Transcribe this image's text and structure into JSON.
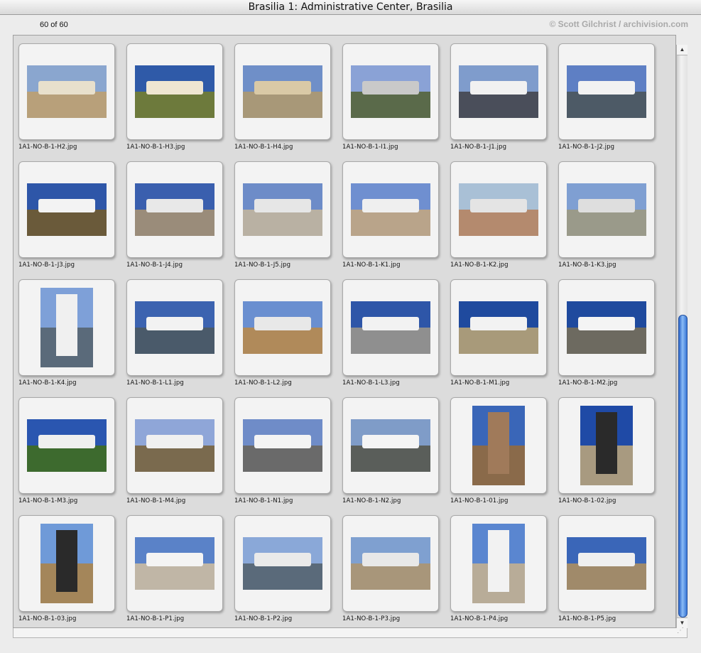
{
  "window": {
    "title": "Brasilia 1: Administrative Center, Brasilia"
  },
  "header": {
    "count": "60 of 60",
    "credit": "© Scott Gilchrist / archivision.com"
  },
  "scrollbar": {
    "up_arrow": "▲",
    "down_arrow": "▼",
    "position": 0.8
  },
  "thumbnails": [
    {
      "filename": "1A1-NO-B-1-H2.jpg",
      "orientation": "landscape",
      "sky": "#8aa6cf",
      "ground": "#b8a07a",
      "structure": "#e8e0cc"
    },
    {
      "filename": "1A1-NO-B-1-H3.jpg",
      "orientation": "landscape",
      "sky": "#2f5aa8",
      "ground": "#6d7a3c",
      "structure": "#efe6d2"
    },
    {
      "filename": "1A1-NO-B-1-H4.jpg",
      "orientation": "landscape",
      "sky": "#6f8fc8",
      "ground": "#a89878",
      "structure": "#d9c9a6"
    },
    {
      "filename": "1A1-NO-B-1-I1.jpg",
      "orientation": "landscape",
      "sky": "#8aa2d6",
      "ground": "#5a6a4a",
      "structure": "#c9c9c9"
    },
    {
      "filename": "1A1-NO-B-1-J1.jpg",
      "orientation": "landscape",
      "sky": "#7f9ccc",
      "ground": "#4a4e5a",
      "structure": "#f1f1f1"
    },
    {
      "filename": "1A1-NO-B-1-J2.jpg",
      "orientation": "landscape",
      "sky": "#5e7fc4",
      "ground": "#4d5a66",
      "structure": "#f2f2f2"
    },
    {
      "filename": "1A1-NO-B-1-J3.jpg",
      "orientation": "landscape",
      "sky": "#2e56a8",
      "ground": "#6a5a3a",
      "structure": "#f3f3f3"
    },
    {
      "filename": "1A1-NO-B-1-J4.jpg",
      "orientation": "landscape",
      "sky": "#3a5fae",
      "ground": "#9a8c7a",
      "structure": "#e8e8e8"
    },
    {
      "filename": "1A1-NO-B-1-J5.jpg",
      "orientation": "landscape",
      "sky": "#6d8cc8",
      "ground": "#b9b1a3",
      "structure": "#e6e6e6"
    },
    {
      "filename": "1A1-NO-B-1-K1.jpg",
      "orientation": "landscape",
      "sky": "#6f8fd0",
      "ground": "#b9a48a",
      "structure": "#efefef"
    },
    {
      "filename": "1A1-NO-B-1-K2.jpg",
      "orientation": "landscape",
      "sky": "#a9c0d6",
      "ground": "#b48a6e",
      "structure": "#e4e4e4"
    },
    {
      "filename": "1A1-NO-B-1-K3.jpg",
      "orientation": "landscape",
      "sky": "#7f9fd2",
      "ground": "#9a9a8a",
      "structure": "#dedede"
    },
    {
      "filename": "1A1-NO-B-1-K4.jpg",
      "orientation": "portrait",
      "sky": "#7ea0d8",
      "ground": "#5a6a7a",
      "structure": "#f0f0f0"
    },
    {
      "filename": "1A1-NO-B-1-L1.jpg",
      "orientation": "landscape",
      "sky": "#3c63b0",
      "ground": "#4a5a6a",
      "structure": "#f2f2f2"
    },
    {
      "filename": "1A1-NO-B-1-L2.jpg",
      "orientation": "landscape",
      "sky": "#6a8fd0",
      "ground": "#b08a5a",
      "structure": "#e8e8e8"
    },
    {
      "filename": "1A1-NO-B-1-L3.jpg",
      "orientation": "landscape",
      "sky": "#2e56a8",
      "ground": "#8f8f8f",
      "structure": "#f2f2f2"
    },
    {
      "filename": "1A1-NO-B-1-M1.jpg",
      "orientation": "landscape",
      "sky": "#1f4a9e",
      "ground": "#a89a7a",
      "structure": "#f2f2f2"
    },
    {
      "filename": "1A1-NO-B-1-M2.jpg",
      "orientation": "landscape",
      "sky": "#1f4a9e",
      "ground": "#6d6a60",
      "structure": "#f4f4f4"
    },
    {
      "filename": "1A1-NO-B-1-M3.jpg",
      "orientation": "landscape",
      "sky": "#2a56b0",
      "ground": "#3d6a2e",
      "structure": "#efefef"
    },
    {
      "filename": "1A1-NO-B-1-M4.jpg",
      "orientation": "landscape",
      "sky": "#8fa6d8",
      "ground": "#7a6a4e",
      "structure": "#f0f0f0"
    },
    {
      "filename": "1A1-NO-B-1-N1.jpg",
      "orientation": "landscape",
      "sky": "#6f8cc8",
      "ground": "#6a6a6a",
      "structure": "#f4f4f4"
    },
    {
      "filename": "1A1-NO-B-1-N2.jpg",
      "orientation": "landscape",
      "sky": "#7f9cc8",
      "ground": "#5a5e5a",
      "structure": "#f4f4f4"
    },
    {
      "filename": "1A1-NO-B-1-01.jpg",
      "orientation": "portrait",
      "sky": "#3a66b8",
      "ground": "#8a6a4a",
      "structure": "#a07a5a"
    },
    {
      "filename": "1A1-NO-B-1-02.jpg",
      "orientation": "portrait",
      "sky": "#1f4aa6",
      "ground": "#a89a80",
      "structure": "#2a2a2a"
    },
    {
      "filename": "1A1-NO-B-1-03.jpg",
      "orientation": "portrait",
      "sky": "#6f9ad8",
      "ground": "#a4865a",
      "structure": "#2a2a2a"
    },
    {
      "filename": "1A1-NO-B-1-P1.jpg",
      "orientation": "landscape",
      "sky": "#5a82c8",
      "ground": "#c0b6a6",
      "structure": "#f4f4f4"
    },
    {
      "filename": "1A1-NO-B-1-P2.jpg",
      "orientation": "landscape",
      "sky": "#8aa8d8",
      "ground": "#5a6a7a",
      "structure": "#eaeaea"
    },
    {
      "filename": "1A1-NO-B-1-P3.jpg",
      "orientation": "landscape",
      "sky": "#7fa0d0",
      "ground": "#a8967a",
      "structure": "#e8e8e8"
    },
    {
      "filename": "1A1-NO-B-1-P4.jpg",
      "orientation": "portrait",
      "sky": "#5a86d0",
      "ground": "#b8ac98",
      "structure": "#f2f2f2"
    },
    {
      "filename": "1A1-NO-B-1-P5.jpg",
      "orientation": "landscape",
      "sky": "#3a66b8",
      "ground": "#a08a6a",
      "structure": "#efefef"
    }
  ]
}
